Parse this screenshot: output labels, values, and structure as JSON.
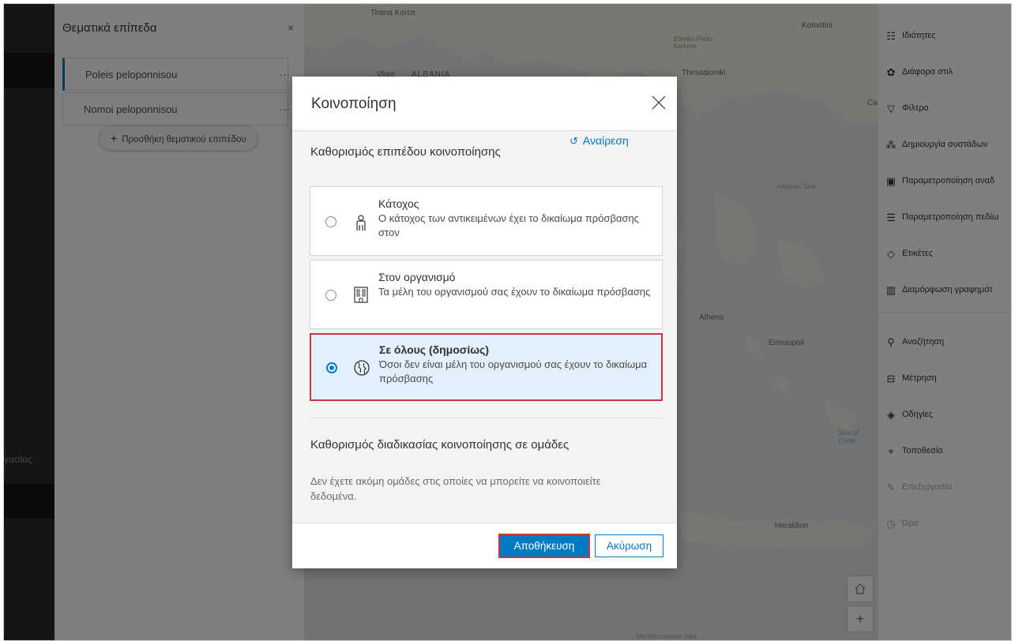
{
  "left_nav": {
    "cut_label": "γασίας"
  },
  "layers_panel": {
    "title": "Θεματικά επίπεδα",
    "close": "×",
    "layers": [
      {
        "name": "Poleis peloponnisou",
        "menu": "..."
      },
      {
        "name": "Nomoi peloponnisou",
        "menu": "..."
      }
    ],
    "add_layer": "Προσθήκη θεματικού επιπέδου",
    "add_symbol": "+"
  },
  "map": {
    "labels": [
      {
        "text": "Tirana Korce",
        "kind": "city"
      },
      {
        "text": "ALBANIA",
        "kind": "country"
      },
      {
        "text": "Vlore",
        "kind": "city"
      },
      {
        "text": "Ethniko Parko Kerkinis",
        "kind": "park"
      },
      {
        "text": "Thessaloniki",
        "kind": "city"
      },
      {
        "text": "Komotini",
        "kind": "city"
      },
      {
        "text": "Ca",
        "kind": "city"
      },
      {
        "text": "Aegean Sea",
        "kind": "sea"
      },
      {
        "text": "Athens",
        "kind": "city"
      },
      {
        "text": "Ermoupoli",
        "kind": "city"
      },
      {
        "text": "Sea of Crete",
        "kind": "sea"
      },
      {
        "text": "Heraklion",
        "kind": "city"
      },
      {
        "text": "Mediterranean Sea",
        "kind": "sea"
      }
    ],
    "home_icon": "home-icon",
    "zoom_in": "+"
  },
  "tools": [
    {
      "label": "Ιδιότητες",
      "icon": "properties-icon",
      "enabled": true
    },
    {
      "label": "Διάφορα στιλ",
      "icon": "styles-icon",
      "enabled": true
    },
    {
      "label": "Φίλτρο",
      "icon": "filter-icon",
      "enabled": true
    },
    {
      "label": "Δημιουργία συστάδων",
      "icon": "clustering-icon",
      "enabled": true
    },
    {
      "label": "Παραμετροποίηση αναδ",
      "icon": "popup-config-icon",
      "enabled": true
    },
    {
      "label": "Παραμετροποίηση πεδίω",
      "icon": "fields-config-icon",
      "enabled": true
    },
    {
      "label": "Ετικέτες",
      "icon": "labels-icon",
      "enabled": true
    },
    {
      "label": "Διαμόρφωση γραφημάτ",
      "icon": "charts-icon",
      "enabled": true
    },
    {
      "label": "Αναζήτηση",
      "icon": "search-icon",
      "enabled": true
    },
    {
      "label": "Μέτρηση",
      "icon": "measure-icon",
      "enabled": true
    },
    {
      "label": "Οδηγίες",
      "icon": "directions-icon",
      "enabled": true
    },
    {
      "label": "Τοποθεσία",
      "icon": "location-icon",
      "enabled": true
    },
    {
      "label": "Επεξεργασία",
      "icon": "edit-icon",
      "enabled": false
    },
    {
      "label": "Ώρα",
      "icon": "time-icon",
      "enabled": false
    }
  ],
  "dialog": {
    "title": "Κοινοποίηση",
    "section1_title": "Καθορισμός επιπέδου κοινοποίησης",
    "reset": "Αναίρεση",
    "options": [
      {
        "title": "Κάτοχος",
        "desc": "Ο κάτοχος των αντικειμένων έχει το δικαίωμα πρόσβασης στον",
        "selected": false,
        "icon": "owner-icon"
      },
      {
        "title": "Στον οργανισμό",
        "desc": "Τα μέλη του οργανισμού σας έχουν το δικαίωμα πρόσβασης",
        "selected": false,
        "icon": "organization-icon"
      },
      {
        "title": "Σε όλους (δημοσίως)",
        "desc": "Όσοι δεν είναι μέλη του οργανισμού σας έχουν το δικαίωμα πρόσβασης",
        "selected": true,
        "icon": "globe-icon"
      }
    ],
    "section2_title": "Καθορισμός διαδικασίας κοινοποίησης σε ομάδες",
    "section2_desc": "Δεν έχετε ακόμη ομάδες στις οποίες να μπορείτε να κοινοποιείτε δεδομένα.",
    "save": "Αποθήκευση",
    "cancel": "Ακύρωση"
  },
  "colors": {
    "accent": "#007ac2",
    "highlight": "#cc3340",
    "selected_bg": "#e1f0fa"
  }
}
